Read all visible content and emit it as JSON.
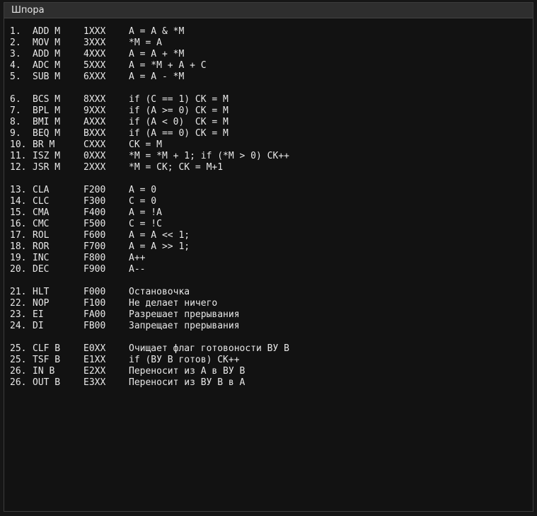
{
  "window": {
    "title": "Шпора"
  },
  "groups": [
    [
      {
        "n": "1.",
        "m": "ADD M",
        "c": "1XXX",
        "d": "A = A & *M"
      },
      {
        "n": "2.",
        "m": "MOV M",
        "c": "3XXX",
        "d": "*M = A"
      },
      {
        "n": "3.",
        "m": "ADD M",
        "c": "4XXX",
        "d": "A = A + *M"
      },
      {
        "n": "4.",
        "m": "ADC M",
        "c": "5XXX",
        "d": "A = *M + A + C"
      },
      {
        "n": "5.",
        "m": "SUB M",
        "c": "6XXX",
        "d": "A = A - *M"
      }
    ],
    [
      {
        "n": "6.",
        "m": "BCS M",
        "c": "8XXX",
        "d": "if (C == 1) CK = M"
      },
      {
        "n": "7.",
        "m": "BPL M",
        "c": "9XXX",
        "d": "if (A >= 0) CK = M"
      },
      {
        "n": "8.",
        "m": "BMI M",
        "c": "AXXX",
        "d": "if (A < 0)  CK = M"
      },
      {
        "n": "9.",
        "m": "BEQ M",
        "c": "BXXX",
        "d": "if (A == 0) CK = M"
      },
      {
        "n": "10.",
        "m": "BR M",
        "c": "CXXX",
        "d": "CK = M"
      },
      {
        "n": "11.",
        "m": "ISZ M",
        "c": "0XXX",
        "d": "*M = *M + 1; if (*M > 0) CK++"
      },
      {
        "n": "12.",
        "m": "JSR M",
        "c": "2XXX",
        "d": "*M = CK; CK = M+1"
      }
    ],
    [
      {
        "n": "13.",
        "m": "CLA",
        "c": "F200",
        "d": "A = 0"
      },
      {
        "n": "14.",
        "m": "CLC",
        "c": "F300",
        "d": "C = 0"
      },
      {
        "n": "15.",
        "m": "CMA",
        "c": "F400",
        "d": "A = !A"
      },
      {
        "n": "16.",
        "m": "CMC",
        "c": "F500",
        "d": "C = !C"
      },
      {
        "n": "17.",
        "m": "ROL",
        "c": "F600",
        "d": "A = A << 1;"
      },
      {
        "n": "18.",
        "m": "ROR",
        "c": "F700",
        "d": "A = A >> 1;"
      },
      {
        "n": "19.",
        "m": "INC",
        "c": "F800",
        "d": "A++"
      },
      {
        "n": "20.",
        "m": "DEC",
        "c": "F900",
        "d": "A--"
      }
    ],
    [
      {
        "n": "21.",
        "m": "HLT",
        "c": "F000",
        "d": "Остановочка"
      },
      {
        "n": "22.",
        "m": "NOP",
        "c": "F100",
        "d": "Не делает ничего"
      },
      {
        "n": "23.",
        "m": "EI",
        "c": "FA00",
        "d": "Разрешает прерывания"
      },
      {
        "n": "24.",
        "m": "DI",
        "c": "FB00",
        "d": "Запрещает прерывания"
      }
    ],
    [
      {
        "n": "25.",
        "m": "CLF B",
        "c": "E0XX",
        "d": "Очищает флаг готовоности ВУ B"
      },
      {
        "n": "25.",
        "m": "TSF B",
        "c": "E1XX",
        "d": "if (ВУ B готов) CK++"
      },
      {
        "n": "26.",
        "m": "IN B",
        "c": "E2XX",
        "d": "Переносит из A в ВУ B"
      },
      {
        "n": "26.",
        "m": "OUT B",
        "c": "E3XX",
        "d": "Переносит из ВУ B в A"
      }
    ]
  ]
}
